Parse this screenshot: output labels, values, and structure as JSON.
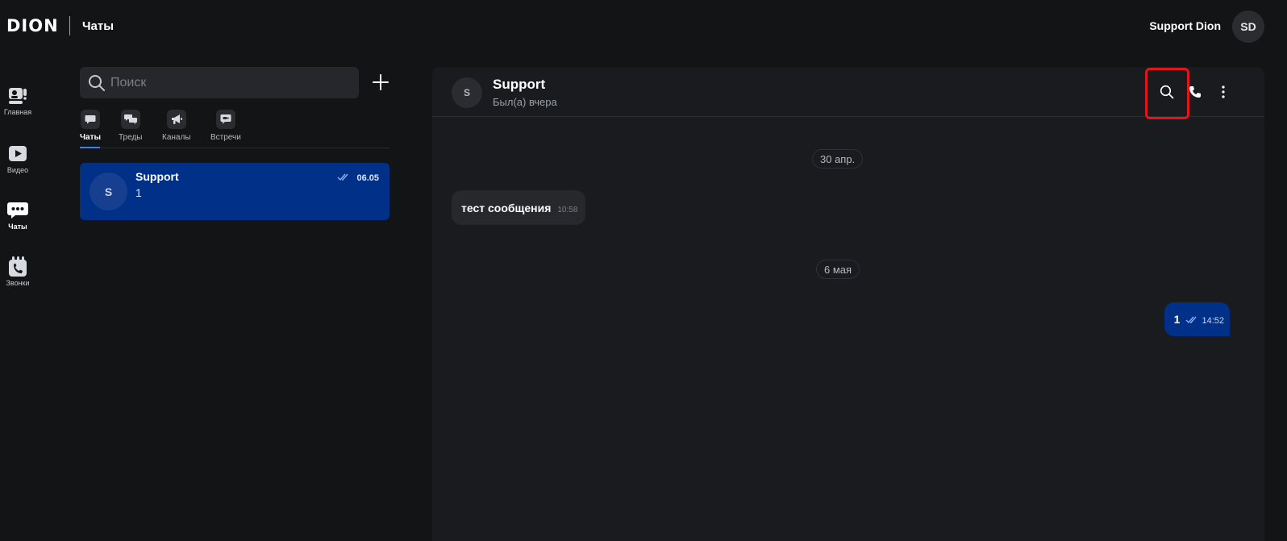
{
  "topbar": {
    "logo": "DION",
    "title": "Чаты",
    "user_name": "Support Dion",
    "user_initials": "SD"
  },
  "rail": {
    "items": [
      {
        "label": "Главная",
        "icon": "video-conference-icon"
      },
      {
        "label": "Видео",
        "icon": "play-icon"
      },
      {
        "label": "Чаты",
        "icon": "chat-icon",
        "active": true
      },
      {
        "label": "Звонки",
        "icon": "calendar-phone-icon"
      }
    ]
  },
  "chat_list": {
    "search_placeholder": "Поиск",
    "tabs": [
      {
        "label": "Чаты",
        "active": true
      },
      {
        "label": "Треды"
      },
      {
        "label": "Каналы"
      },
      {
        "label": "Встречи"
      }
    ],
    "items": [
      {
        "avatar": "S",
        "name": "Support",
        "preview": "1",
        "date": "06.05",
        "read": true
      }
    ]
  },
  "conversation": {
    "avatar": "S",
    "name": "Support",
    "status": "Был(а) вчера",
    "dates": [
      "30 апр.",
      "6 мая"
    ],
    "messages": [
      {
        "direction": "in",
        "text": "тест сообщения",
        "time": "10:58"
      },
      {
        "direction": "out",
        "text": "1",
        "time": "14:52",
        "read": true
      }
    ]
  },
  "colors": {
    "background": "#131416",
    "panel": "#1a1b1e",
    "accent_blue": "#003088",
    "highlight_red": "#e2141c"
  }
}
